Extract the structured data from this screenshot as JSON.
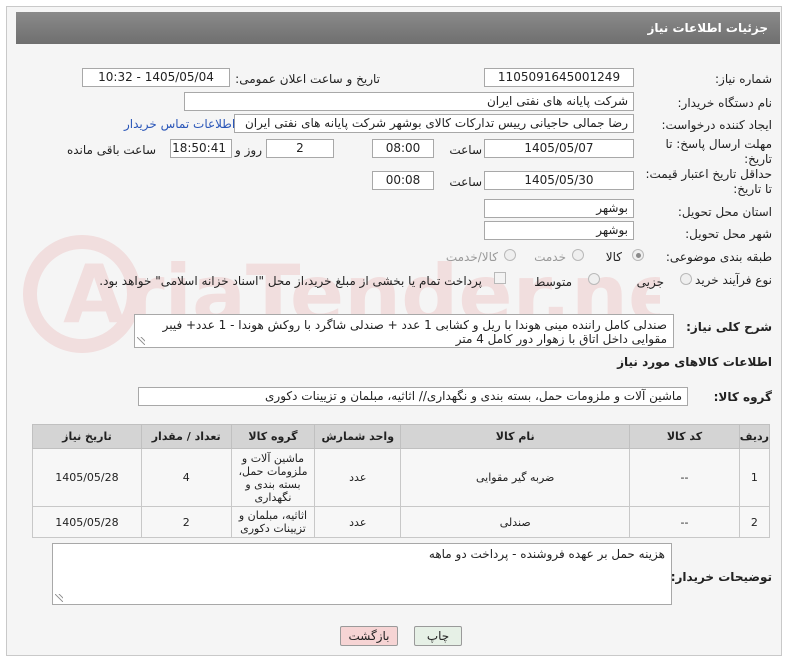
{
  "header": {
    "title": "جزئیات اطلاعات نیاز"
  },
  "form": {
    "need_number_label": "شماره نیاز:",
    "need_number": "1105091645001249",
    "announce_label": "تاریخ و ساعت اعلان عمومی:",
    "announce_value": "1405/05/04 - 10:32",
    "buyer_org_label": "نام دستگاه خریدار:",
    "buyer_org": "شرکت پایانه های نفتی ایران",
    "creator_label": "ایجاد کننده درخواست:",
    "creator": "رضا جمالی حاجیانی رییس تدارکات کالای بوشهر شرکت پایانه های نفتی ایران",
    "contact_link": "اطلاعات تماس خریدار",
    "deadline_label": "مهلت ارسال پاسخ: تا تاریخ:",
    "deadline_date": "1405/05/07",
    "time_label": "ساعت",
    "deadline_time": "08:00",
    "days_value": "2",
    "days_label": "روز و",
    "remaining_time": "18:50:41",
    "remaining_label": "ساعت باقی مانده",
    "validity_label": "حداقل تاریخ اعتبار قیمت: تا تاریخ:",
    "validity_date": "1405/05/30",
    "validity_time": "00:08",
    "province_label": "استان محل تحویل:",
    "province": "بوشهر",
    "city_label": "شهر محل تحویل:",
    "city": "بوشهر",
    "category_label": "طبقه بندی موضوعی:",
    "category_options": [
      "کالا",
      "خدمت",
      "کالا/خدمت"
    ],
    "process_label": "نوع فرآیند خرید :",
    "process_options": [
      "جزیی",
      "متوسط"
    ],
    "treasury_note": "پرداخت تمام یا بخشی از مبلغ خرید،از محل \"اسناد خزانه اسلامی\" خواهد بود."
  },
  "description": {
    "label": "شرح کلی نیاز:",
    "text": "صندلی کامل راننده مینی هوندا با ریل و کشابی 1 عدد + صندلی شاگرد با روکش هوندا - 1 عدد+ فیبر مقوایی داخل اتاق با زهوار دور کامل 4 متر"
  },
  "goods_info": {
    "heading": "اطلاعات کالاهای مورد نیاز",
    "group_label": "گروه کالا:",
    "group_value": "ماشین آلات و ملزومات حمل، بسته بندی و نگهداری// اثاثیه، مبلمان و تزیینات دکوری"
  },
  "table": {
    "columns": [
      "ردیف",
      "کد کالا",
      "نام کالا",
      "واحد شمارش",
      "گروه کالا",
      "تعداد / مقدار",
      "تاریخ نیاز"
    ],
    "rows": [
      [
        "1",
        "--",
        "ضربه گیر مقوایی",
        "عدد",
        "ماشین آلات و ملزومات حمل، بسته بندی و نگهداری",
        "4",
        "1405/05/28"
      ],
      [
        "2",
        "--",
        "صندلی",
        "عدد",
        "اثاثیه، مبلمان و تزیینات دکوری",
        "2",
        "1405/05/28"
      ]
    ]
  },
  "buyer_notes": {
    "label": "توضیحات خریدار:",
    "text": "هزینه حمل بر عهده فروشنده - پرداخت دو ماهه"
  },
  "buttons": {
    "print": "چاپ",
    "back": "بازگشت"
  },
  "watermark": {
    "text": "AriaTender.neT"
  },
  "colors": {
    "titlebar": "#7a7a7a",
    "link": "#2a56b8",
    "back_button": "#f6d4d4",
    "print_button": "#e6f0e6"
  }
}
